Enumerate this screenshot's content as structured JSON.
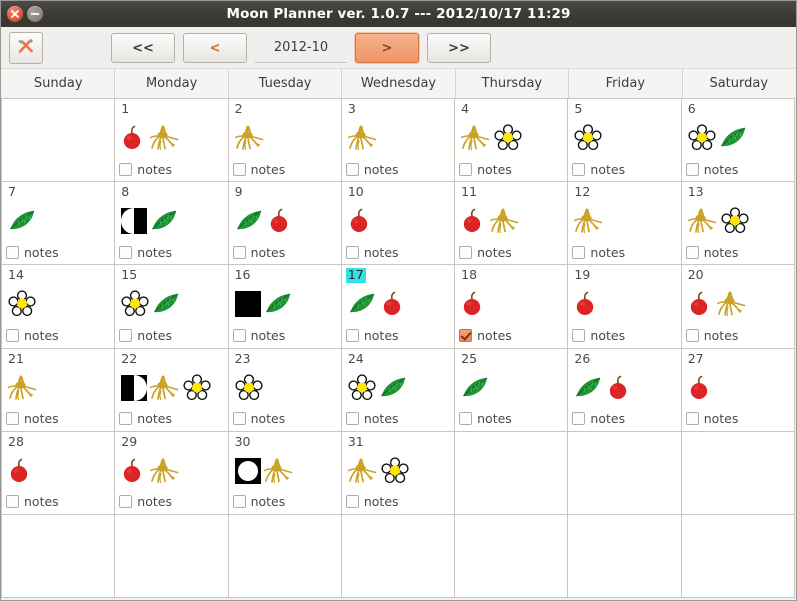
{
  "window": {
    "title": "Moon Planner ver. 1.0.7  ---  2012/10/17 11:29",
    "close_label": "close",
    "minimize_label": "minimize"
  },
  "toolbar": {
    "tools_label": "tools",
    "first_label": "<<",
    "prev_label": "<",
    "month_value": "2012-10",
    "next_label": ">",
    "last_label": ">>"
  },
  "calendar": {
    "weekdays": [
      "Sunday",
      "Monday",
      "Tuesday",
      "Wednesday",
      "Thursday",
      "Friday",
      "Saturday"
    ],
    "notes_label": "notes",
    "today": "17",
    "colors": {
      "fruit": "#dc2426",
      "root": "#c9a227",
      "leaf": "#1e9434",
      "flower_center": "#ffe800",
      "today_highlight": "#33e0e8",
      "accent": "#ef9566"
    },
    "icon_names": [
      "fruit-icon",
      "root-icon",
      "leaf-icon",
      "flower-icon",
      "moon-new-icon",
      "moon-first-quarter-icon",
      "moon-full-icon",
      "moon-last-quarter-icon"
    ],
    "weeks": [
      [
        {
          "day": "",
          "icons": [],
          "notes": false,
          "blank": true
        },
        {
          "day": "1",
          "icons": [
            "fruit",
            "root"
          ],
          "notes": false
        },
        {
          "day": "2",
          "icons": [
            "root"
          ],
          "notes": false
        },
        {
          "day": "3",
          "icons": [
            "root"
          ],
          "notes": false
        },
        {
          "day": "4",
          "icons": [
            "root",
            "flower"
          ],
          "notes": false
        },
        {
          "day": "5",
          "icons": [
            "flower"
          ],
          "notes": false
        },
        {
          "day": "6",
          "icons": [
            "flower",
            "leaf"
          ],
          "notes": false
        }
      ],
      [
        {
          "day": "7",
          "icons": [
            "leaf"
          ],
          "notes": false
        },
        {
          "day": "8",
          "icons": [
            "moon_last",
            "leaf"
          ],
          "notes": false
        },
        {
          "day": "9",
          "icons": [
            "leaf",
            "fruit"
          ],
          "notes": false
        },
        {
          "day": "10",
          "icons": [
            "fruit"
          ],
          "notes": false
        },
        {
          "day": "11",
          "icons": [
            "fruit",
            "root"
          ],
          "notes": false
        },
        {
          "day": "12",
          "icons": [
            "root"
          ],
          "notes": false
        },
        {
          "day": "13",
          "icons": [
            "root",
            "flower"
          ],
          "notes": false
        }
      ],
      [
        {
          "day": "14",
          "icons": [
            "flower"
          ],
          "notes": false
        },
        {
          "day": "15",
          "icons": [
            "flower",
            "leaf"
          ],
          "notes": false
        },
        {
          "day": "16",
          "icons": [
            "moon_new",
            "leaf"
          ],
          "notes": false
        },
        {
          "day": "17",
          "icons": [
            "leaf",
            "fruit"
          ],
          "notes": false,
          "today": true
        },
        {
          "day": "18",
          "icons": [
            "fruit"
          ],
          "notes": true
        },
        {
          "day": "19",
          "icons": [
            "fruit"
          ],
          "notes": false
        },
        {
          "day": "20",
          "icons": [
            "fruit",
            "root"
          ],
          "notes": false
        }
      ],
      [
        {
          "day": "21",
          "icons": [
            "root"
          ],
          "notes": false
        },
        {
          "day": "22",
          "icons": [
            "moon_first",
            "root",
            "flower"
          ],
          "notes": false
        },
        {
          "day": "23",
          "icons": [
            "flower"
          ],
          "notes": false
        },
        {
          "day": "24",
          "icons": [
            "flower",
            "leaf"
          ],
          "notes": false
        },
        {
          "day": "25",
          "icons": [
            "leaf"
          ],
          "notes": false
        },
        {
          "day": "26",
          "icons": [
            "leaf",
            "fruit"
          ],
          "notes": false
        },
        {
          "day": "27",
          "icons": [
            "fruit"
          ],
          "notes": false
        }
      ],
      [
        {
          "day": "28",
          "icons": [
            "fruit"
          ],
          "notes": false
        },
        {
          "day": "29",
          "icons": [
            "fruit",
            "root"
          ],
          "notes": false
        },
        {
          "day": "30",
          "icons": [
            "moon_full",
            "root"
          ],
          "notes": false
        },
        {
          "day": "31",
          "icons": [
            "root",
            "flower"
          ],
          "notes": false
        },
        {
          "day": "",
          "icons": [],
          "notes": false,
          "blank": true
        },
        {
          "day": "",
          "icons": [],
          "notes": false,
          "blank": true
        },
        {
          "day": "",
          "icons": [],
          "notes": false,
          "blank": true
        }
      ],
      [
        {
          "day": "",
          "icons": [],
          "notes": false,
          "blank": true
        },
        {
          "day": "",
          "icons": [],
          "notes": false,
          "blank": true
        },
        {
          "day": "",
          "icons": [],
          "notes": false,
          "blank": true
        },
        {
          "day": "",
          "icons": [],
          "notes": false,
          "blank": true
        },
        {
          "day": "",
          "icons": [],
          "notes": false,
          "blank": true
        },
        {
          "day": "",
          "icons": [],
          "notes": false,
          "blank": true
        },
        {
          "day": "",
          "icons": [],
          "notes": false,
          "blank": true
        }
      ]
    ]
  }
}
